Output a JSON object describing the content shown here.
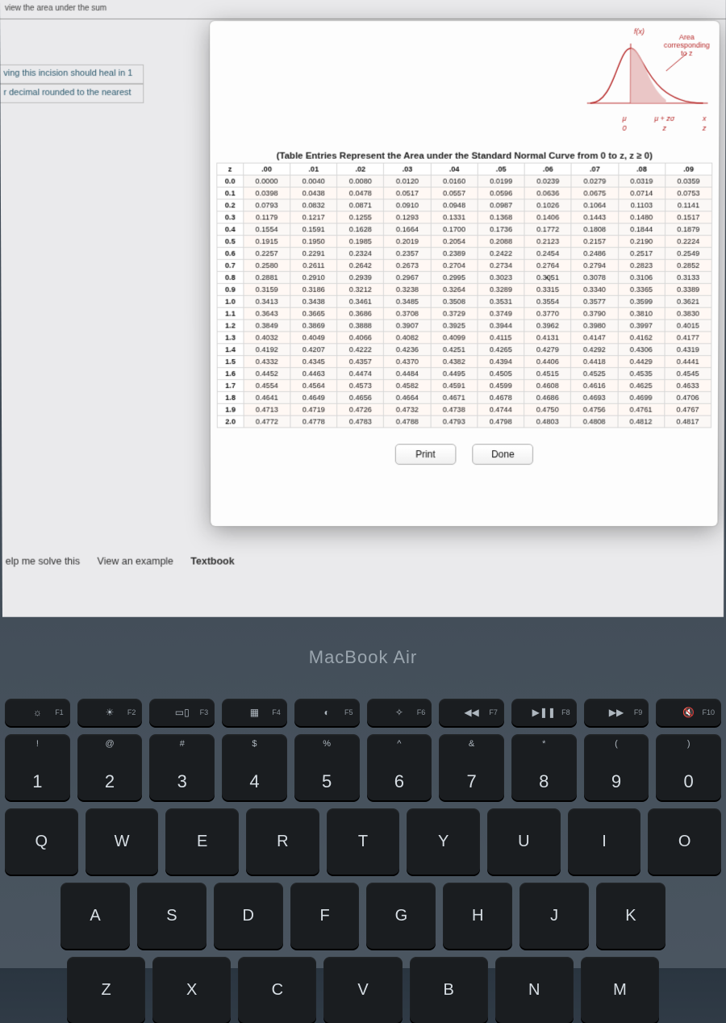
{
  "cutoff_text": "view the area under the sum",
  "left_snippets": [
    "ving this incision should heal in 1",
    "r decimal rounded to the nearest"
  ],
  "curve": {
    "fx_label": "f(x)",
    "area_label_lines": [
      "Area",
      "corresponding",
      "to z"
    ],
    "axis_mu": "μ",
    "axis_muz": "μ + zσ",
    "axis_x": "x",
    "axis_0": "0",
    "axis_z": "z",
    "axis_z2": "z"
  },
  "table_title": "(Table Entries Represent the Area under the Standard Normal Curve from 0 to z, z ≥ 0)",
  "chart_data": {
    "type": "table",
    "title": "Standard Normal Curve area from 0 to z",
    "col_headers": [
      "z",
      ".00",
      ".01",
      ".02",
      ".03",
      ".04",
      ".05",
      ".06",
      ".07",
      ".08",
      ".09"
    ],
    "rows": [
      [
        "0.0",
        "0.0000",
        "0.0040",
        "0.0080",
        "0.0120",
        "0.0160",
        "0.0199",
        "0.0239",
        "0.0279",
        "0.0319",
        "0.0359"
      ],
      [
        "0.1",
        "0.0398",
        "0.0438",
        "0.0478",
        "0.0517",
        "0.0557",
        "0.0596",
        "0.0636",
        "0.0675",
        "0.0714",
        "0.0753"
      ],
      [
        "0.2",
        "0.0793",
        "0.0832",
        "0.0871",
        "0.0910",
        "0.0948",
        "0.0987",
        "0.1026",
        "0.1064",
        "0.1103",
        "0.1141"
      ],
      [
        "0.3",
        "0.1179",
        "0.1217",
        "0.1255",
        "0.1293",
        "0.1331",
        "0.1368",
        "0.1406",
        "0.1443",
        "0.1480",
        "0.1517"
      ],
      [
        "0.4",
        "0.1554",
        "0.1591",
        "0.1628",
        "0.1664",
        "0.1700",
        "0.1736",
        "0.1772",
        "0.1808",
        "0.1844",
        "0.1879"
      ],
      [
        "0.5",
        "0.1915",
        "0.1950",
        "0.1985",
        "0.2019",
        "0.2054",
        "0.2088",
        "0.2123",
        "0.2157",
        "0.2190",
        "0.2224"
      ],
      [
        "0.6",
        "0.2257",
        "0.2291",
        "0.2324",
        "0.2357",
        "0.2389",
        "0.2422",
        "0.2454",
        "0.2486",
        "0.2517",
        "0.2549"
      ],
      [
        "0.7",
        "0.2580",
        "0.2611",
        "0.2642",
        "0.2673",
        "0.2704",
        "0.2734",
        "0.2764",
        "0.2794",
        "0.2823",
        "0.2852"
      ],
      [
        "0.8",
        "0.2881",
        "0.2910",
        "0.2939",
        "0.2967",
        "0.2995",
        "0.3023",
        "0.3051",
        "0.3078",
        "0.3106",
        "0.3133"
      ],
      [
        "0.9",
        "0.3159",
        "0.3186",
        "0.3212",
        "0.3238",
        "0.3264",
        "0.3289",
        "0.3315",
        "0.3340",
        "0.3365",
        "0.3389"
      ],
      [
        "1.0",
        "0.3413",
        "0.3438",
        "0.3461",
        "0.3485",
        "0.3508",
        "0.3531",
        "0.3554",
        "0.3577",
        "0.3599",
        "0.3621"
      ],
      [
        "1.1",
        "0.3643",
        "0.3665",
        "0.3686",
        "0.3708",
        "0.3729",
        "0.3749",
        "0.3770",
        "0.3790",
        "0.3810",
        "0.3830"
      ],
      [
        "1.2",
        "0.3849",
        "0.3869",
        "0.3888",
        "0.3907",
        "0.3925",
        "0.3944",
        "0.3962",
        "0.3980",
        "0.3997",
        "0.4015"
      ],
      [
        "1.3",
        "0.4032",
        "0.4049",
        "0.4066",
        "0.4082",
        "0.4099",
        "0.4115",
        "0.4131",
        "0.4147",
        "0.4162",
        "0.4177"
      ],
      [
        "1.4",
        "0.4192",
        "0.4207",
        "0.4222",
        "0.4236",
        "0.4251",
        "0.4265",
        "0.4279",
        "0.4292",
        "0.4306",
        "0.4319"
      ],
      [
        "1.5",
        "0.4332",
        "0.4345",
        "0.4357",
        "0.4370",
        "0.4382",
        "0.4394",
        "0.4406",
        "0.4418",
        "0.4429",
        "0.4441"
      ],
      [
        "1.6",
        "0.4452",
        "0.4463",
        "0.4474",
        "0.4484",
        "0.4495",
        "0.4505",
        "0.4515",
        "0.4525",
        "0.4535",
        "0.4545"
      ],
      [
        "1.7",
        "0.4554",
        "0.4564",
        "0.4573",
        "0.4582",
        "0.4591",
        "0.4599",
        "0.4608",
        "0.4616",
        "0.4625",
        "0.4633"
      ],
      [
        "1.8",
        "0.4641",
        "0.4649",
        "0.4656",
        "0.4664",
        "0.4671",
        "0.4678",
        "0.4686",
        "0.4693",
        "0.4699",
        "0.4706"
      ],
      [
        "1.9",
        "0.4713",
        "0.4719",
        "0.4726",
        "0.4732",
        "0.4738",
        "0.4744",
        "0.4750",
        "0.4756",
        "0.4761",
        "0.4767"
      ],
      [
        "2.0",
        "0.4772",
        "0.4778",
        "0.4783",
        "0.4788",
        "0.4793",
        "0.4798",
        "0.4803",
        "0.4808",
        "0.4812",
        "0.4817"
      ]
    ]
  },
  "buttons": {
    "print": "Print",
    "done": "Done"
  },
  "help_bar": {
    "help": "elp me solve this",
    "view_example": "View an example",
    "textbook": "Textbook"
  },
  "brand": "MacBook Air",
  "fn_row": [
    {
      "icon": "☼",
      "fx": "F1"
    },
    {
      "icon": "☀",
      "fx": "F2"
    },
    {
      "icon": "▭▯",
      "fx": "F3"
    },
    {
      "icon": "▦",
      "fx": "F4"
    },
    {
      "icon": "◐",
      "fx": "F5"
    },
    {
      "icon": "✧",
      "fx": "F6"
    },
    {
      "icon": "◀◀",
      "fx": "F7"
    },
    {
      "icon": "▶❚❚",
      "fx": "F8"
    },
    {
      "icon": "▶▶",
      "fx": "F9"
    },
    {
      "icon": "🔇",
      "fx": "F10"
    }
  ],
  "num_row": [
    {
      "upper": "!",
      "lower": "1"
    },
    {
      "upper": "@",
      "lower": "2"
    },
    {
      "upper": "#",
      "lower": "3"
    },
    {
      "upper": "$",
      "lower": "4"
    },
    {
      "upper": "%",
      "lower": "5"
    },
    {
      "upper": "^",
      "lower": "6"
    },
    {
      "upper": "&",
      "lower": "7"
    },
    {
      "upper": "*",
      "lower": "8"
    },
    {
      "upper": "(",
      "lower": "9"
    },
    {
      "upper": ")",
      "lower": "0"
    }
  ],
  "rows": {
    "r1": [
      "Q",
      "W",
      "E",
      "R",
      "T",
      "Y",
      "U",
      "I",
      "O"
    ],
    "r2": [
      "A",
      "S",
      "D",
      "F",
      "G",
      "H",
      "J",
      "K"
    ],
    "r3": [
      "Z",
      "X",
      "C",
      "V",
      "B",
      "N",
      "M"
    ]
  }
}
